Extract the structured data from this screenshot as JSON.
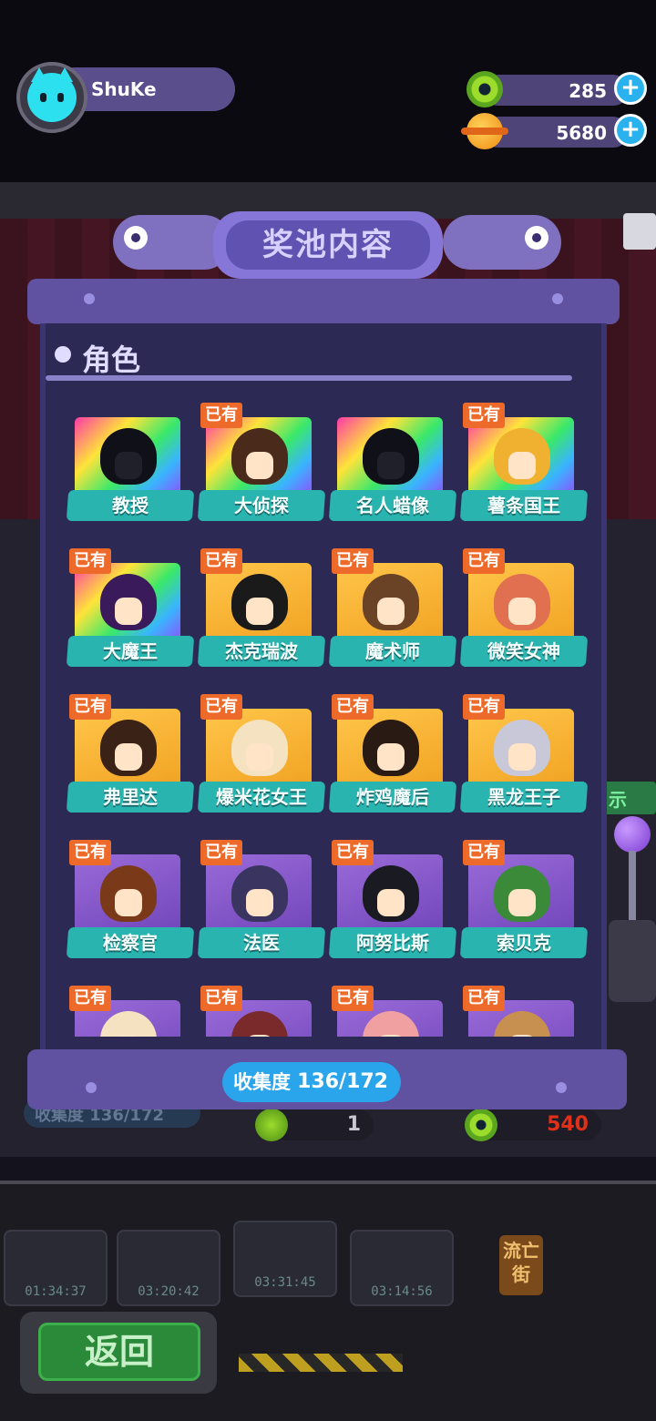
{
  "player": {
    "name": "ShuKe"
  },
  "currencies": [
    {
      "id": "green",
      "amount": "285",
      "color": "#9bdc2c"
    },
    {
      "id": "orange",
      "amount": "5680",
      "color": "#f08a12"
    }
  ],
  "panel": {
    "title": "奖池内容",
    "section_title": "角色",
    "collection_label": "收集度",
    "collection_value": "136/172"
  },
  "owned_badge": "已有",
  "characters": [
    {
      "name": "教授",
      "owned": false,
      "frame": "rainbow",
      "hair": "#101018",
      "silhouette": true
    },
    {
      "name": "大侦探",
      "owned": true,
      "frame": "rainbow",
      "hair": "#4a2a1a",
      "silhouette": false
    },
    {
      "name": "名人蜡像",
      "owned": false,
      "frame": "rainbow",
      "hair": "#101018",
      "silhouette": true
    },
    {
      "name": "薯条国王",
      "owned": true,
      "frame": "rainbow",
      "hair": "#f0b030",
      "silhouette": false
    },
    {
      "name": "大魔王",
      "owned": true,
      "frame": "rainbow",
      "hair": "#3a1a5a",
      "silhouette": false
    },
    {
      "name": "杰克瑞波",
      "owned": true,
      "frame": "gold",
      "hair": "#1a1a1a",
      "silhouette": false
    },
    {
      "name": "魔术师",
      "owned": true,
      "frame": "gold",
      "hair": "#6a4226",
      "silhouette": false
    },
    {
      "name": "微笑女神",
      "owned": true,
      "frame": "gold",
      "hair": "#e07050",
      "silhouette": false
    },
    {
      "name": "弗里达",
      "owned": true,
      "frame": "gold",
      "hair": "#3a2216",
      "silhouette": false
    },
    {
      "name": "爆米花女王",
      "owned": true,
      "frame": "gold",
      "hair": "#f4e2c0",
      "silhouette": false
    },
    {
      "name": "炸鸡魔后",
      "owned": true,
      "frame": "gold",
      "hair": "#2a1a14",
      "silhouette": false
    },
    {
      "name": "黑龙王子",
      "owned": true,
      "frame": "gold",
      "hair": "#c8c8d8",
      "silhouette": false
    },
    {
      "name": "检察官",
      "owned": true,
      "frame": "purple",
      "hair": "#7a3a1a",
      "silhouette": false
    },
    {
      "name": "法医",
      "owned": true,
      "frame": "purple",
      "hair": "#3a3460",
      "silhouette": false
    },
    {
      "name": "阿努比斯",
      "owned": true,
      "frame": "purple",
      "hair": "#1a1a22",
      "silhouette": false
    },
    {
      "name": "索贝克",
      "owned": true,
      "frame": "purple",
      "hair": "#3a8a3a",
      "silhouette": false
    },
    {
      "name": "",
      "owned": true,
      "frame": "purple",
      "hair": "#f4e2c0",
      "silhouette": false
    },
    {
      "name": "",
      "owned": true,
      "frame": "purple",
      "hair": "#7a2a2a",
      "silhouette": false
    },
    {
      "name": "",
      "owned": true,
      "frame": "purple",
      "hair": "#f0a0a0",
      "silhouette": false
    },
    {
      "name": "",
      "owned": true,
      "frame": "purple",
      "hair": "#c89050",
      "silhouette": false
    }
  ],
  "background": {
    "collection_text": "收集度 136/172",
    "cost_green": "1",
    "cost_red": "540",
    "timers": [
      "01:34:37",
      "03:20:42",
      "03:31:45",
      "03:14:56"
    ],
    "street_sign": "流亡街",
    "side_tag": "示",
    "back_label": "返回"
  }
}
